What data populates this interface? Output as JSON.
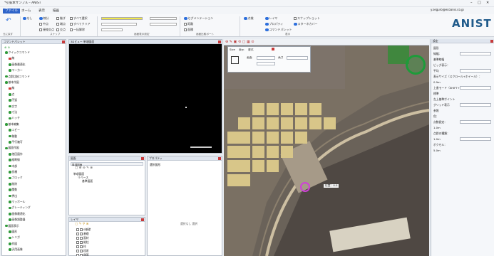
{
  "window": {
    "title": "*引張本サンプル - ANIST",
    "user": "y.seguro@ecoanis.co.jp"
  },
  "menu": [
    "ファイル",
    "ホーム",
    "表示",
    "描画"
  ],
  "ribbon": {
    "row1": [
      "なし",
      "線分",
      "継ぎ",
      "すべて選択",
      "セグメンテーション",
      "点検",
      "レイヤ",
      "スナップショット"
    ],
    "row2": [
      "中点",
      "端点",
      "すべてクリア",
      "距離",
      "面積",
      "プロパティ",
      "スターネカバー"
    ],
    "row3": [
      "接線交点",
      "交点",
      "一括解除",
      "コマンドパレット"
    ],
    "groups": [
      "元に戻す",
      "スナップ",
      "画面表示設定",
      "画面比較ボート",
      "表示"
    ],
    "brand": "ANIST"
  },
  "command_panel": {
    "title": "コマンドパレット",
    "items": [
      "クイックコマンド",
      "線",
      "画像最適化",
      "マーカー",
      "点群比較コマンド",
      "基本作図",
      "線",
      "点",
      "円弧",
      "文字",
      "寸法",
      "ハッチ",
      "基本編集",
      "コピー",
      "移動",
      "平行複写",
      "図面作図",
      "他回図作",
      "縦断線",
      "木部",
      "伐柵",
      "ブロック",
      "削除",
      "関数",
      "押出",
      "マッポール",
      "グレーティング",
      "画像最適化",
      "画像調整器",
      "図面表示",
      "図形",
      "トリガ",
      "作図",
      "汎用画像"
    ]
  },
  "view_panel": {
    "title": "3Dビュー 単項図面"
  },
  "layer_tree": {
    "title": "図面",
    "root": "単項図面",
    "children": [
      "リベース",
      "基準図面"
    ]
  },
  "properties": {
    "title": "プロパティ",
    "field": "選択図形",
    "empty": "選択なし 選択"
  },
  "layers": {
    "title": "レイヤ",
    "items": [
      "0基礎",
      "基礎",
      "面材",
      "縦柱",
      "柱",
      "段差",
      "側面"
    ]
  },
  "map": {
    "label": "位置：0.0",
    "tool_labels": [
      "Size",
      "表示",
      "書式",
      "画面",
      "高さ"
    ]
  },
  "right_panel": {
    "title": "設定",
    "rows": [
      "図形",
      "線幅：",
      "基準線幅",
      "ビッグ表示：",
      "平均",
      "表示サイズ（スクロール+ホイール）：",
      "0.9m",
      "上書モード（SHIFT+ホイール）",
      "標準",
      "左上基準ポイント",
      "グリッド表示",
      "参照",
      "色：",
      "点数設定：",
      "1.0m",
      "点群の種類：",
      "1.0m",
      "ボクセル：",
      "5.0m"
    ]
  },
  "colors": {
    "accent": "#2f64c9",
    "brand": "#1f5a8a",
    "ok": "#2f9a3a",
    "close": "#c83a3a"
  }
}
